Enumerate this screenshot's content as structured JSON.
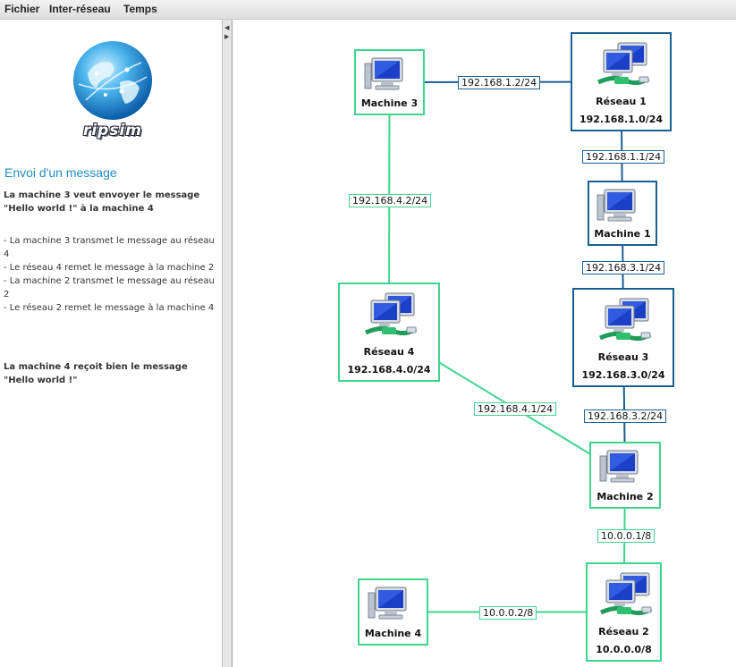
{
  "menu": [
    "Fichier",
    "Inter-réseau",
    "Temps"
  ],
  "logo_text": "ripsim",
  "panel": {
    "title": "Envoi d'un message",
    "intro": "La machine 3 veut envoyer le message \"Hello world !\" à la machine 4",
    "steps": [
      "- La machine 3 transmet le message au réseau 4",
      "- Le réseau 4 remet le message à la machine 2",
      "- La machine 2 transmet le message au réseau 2",
      "- Le réseau 2 remet le message à la machine 4"
    ],
    "conclusion": "La machine 4 reçoit bien le message \"Hello world !\""
  },
  "nodes": {
    "machine3": {
      "name": "Machine 3",
      "kind": "machine",
      "color": "green"
    },
    "reseau1": {
      "name": "Réseau 1",
      "subnet": "192.168.1.0/24",
      "kind": "network",
      "color": "blue"
    },
    "machine1": {
      "name": "Machine 1",
      "kind": "machine",
      "color": "blue"
    },
    "reseau3": {
      "name": "Réseau 3",
      "subnet": "192.168.3.0/24",
      "kind": "network",
      "color": "blue"
    },
    "reseau4": {
      "name": "Réseau 4",
      "subnet": "192.168.4.0/24",
      "kind": "network",
      "color": "green"
    },
    "machine2": {
      "name": "Machine 2",
      "kind": "machine",
      "color": "green"
    },
    "reseau2": {
      "name": "Réseau 2",
      "subnet": "10.0.0.0/8",
      "kind": "network",
      "color": "green"
    },
    "machine4": {
      "name": "Machine 4",
      "kind": "machine",
      "color": "green"
    }
  },
  "links": [
    {
      "from": "machine3",
      "to": "reseau1",
      "ip": "192.168.1.2/24",
      "color": "blue"
    },
    {
      "from": "reseau1",
      "to": "machine1",
      "ip": "192.168.1.1/24",
      "color": "blue"
    },
    {
      "from": "machine1",
      "to": "reseau3",
      "ip": "192.168.3.1/24",
      "color": "blue"
    },
    {
      "from": "reseau3",
      "to": "machine2",
      "ip": "192.168.3.2/24",
      "color": "blue"
    },
    {
      "from": "machine3",
      "to": "reseau4",
      "ip": "192.168.4.2/24",
      "color": "green"
    },
    {
      "from": "reseau4",
      "to": "machine2",
      "ip": "192.168.4.1/24",
      "color": "green"
    },
    {
      "from": "machine2",
      "to": "reseau2",
      "ip": "10.0.0.1/8",
      "color": "green"
    },
    {
      "from": "machine4",
      "to": "reseau2",
      "ip": "10.0.0.2/8",
      "color": "green"
    }
  ],
  "colors": {
    "green": "#3fd48e",
    "blue": "#1a5f93",
    "title": "#1f8cc4"
  }
}
